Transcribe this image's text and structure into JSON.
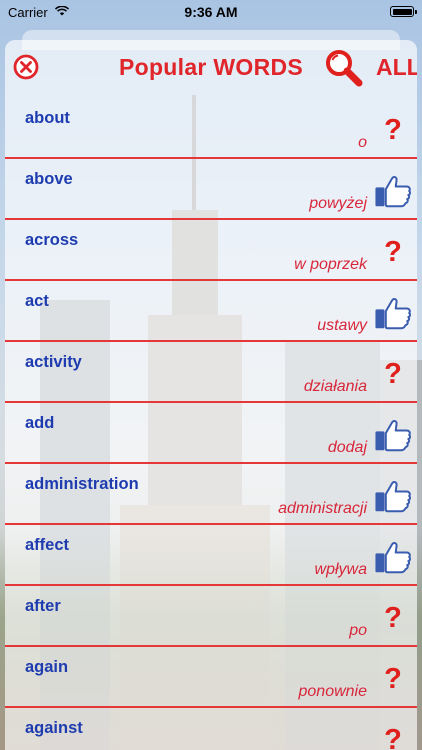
{
  "status_bar": {
    "carrier": "Carrier",
    "time": "9:36 AM"
  },
  "header": {
    "title": "Popular WORDS",
    "all_label": "ALL",
    "close_icon": "close-circle-icon",
    "search_icon": "magnifier-icon"
  },
  "colors": {
    "accent_red": "#e0252b",
    "english_blue": "#1e3cb0",
    "polish_red": "#d8263a",
    "like_blue": "#3b5db0"
  },
  "words": [
    {
      "en": "about",
      "pl": "o",
      "status": "unknown"
    },
    {
      "en": "above",
      "pl": "powyżej",
      "status": "liked"
    },
    {
      "en": "across",
      "pl": "w poprzek",
      "status": "unknown"
    },
    {
      "en": "act",
      "pl": "ustawy",
      "status": "liked"
    },
    {
      "en": "activity",
      "pl": "działania",
      "status": "unknown"
    },
    {
      "en": "add",
      "pl": "dodaj",
      "status": "liked"
    },
    {
      "en": "administration",
      "pl": "administracji",
      "status": "liked"
    },
    {
      "en": "affect",
      "pl": "wpływa",
      "status": "liked"
    },
    {
      "en": "after",
      "pl": "po",
      "status": "unknown"
    },
    {
      "en": "again",
      "pl": "ponownie",
      "status": "unknown"
    },
    {
      "en": "against",
      "pl": "",
      "status": "unknown"
    }
  ]
}
